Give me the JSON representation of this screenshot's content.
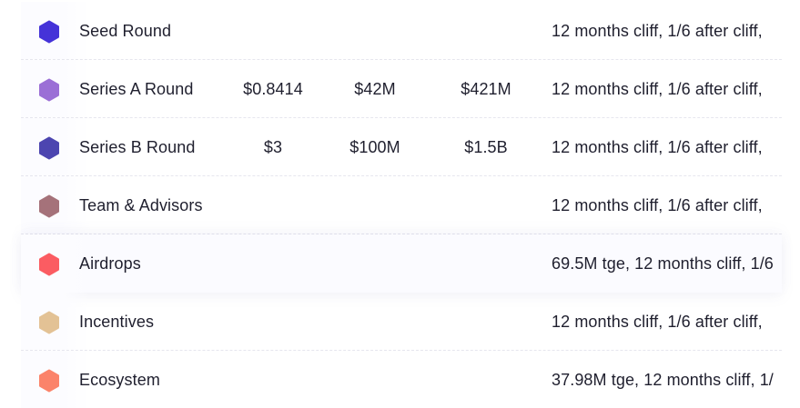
{
  "rows": [
    {
      "name": "Seed Round",
      "price": "",
      "raise": "",
      "valuation": "",
      "vesting": "12 months cliff, 1/6 after cliff,",
      "color": "#4533d8"
    },
    {
      "name": "Series A Round",
      "price": "$0.8414",
      "raise": "$42M",
      "valuation": "$421M",
      "vesting": "12 months cliff, 1/6 after cliff,",
      "color": "#9b6fd6"
    },
    {
      "name": "Series B Round",
      "price": "$3",
      "raise": "$100M",
      "valuation": "$1.5B",
      "vesting": "12 months cliff, 1/6 after cliff,",
      "color": "#4c45b0"
    },
    {
      "name": "Team & Advisors",
      "price": "",
      "raise": "",
      "valuation": "",
      "vesting": "12 months cliff, 1/6 after cliff,",
      "color": "#a5727a"
    },
    {
      "name": "Airdrops",
      "price": "",
      "raise": "",
      "valuation": "",
      "vesting": "69.5M tge, 12 months cliff, 1/6",
      "color": "#fb5c62"
    },
    {
      "name": "Incentives",
      "price": "",
      "raise": "",
      "valuation": "",
      "vesting": "12 months cliff, 1/6 after cliff,",
      "color": "#e3c295"
    },
    {
      "name": "Ecosystem",
      "price": "",
      "raise": "",
      "valuation": "",
      "vesting": "37.98M tge, 12 months cliff, 1/",
      "color": "#fb836a"
    }
  ],
  "icons": {
    "row_marker": "hexagon-icon"
  }
}
